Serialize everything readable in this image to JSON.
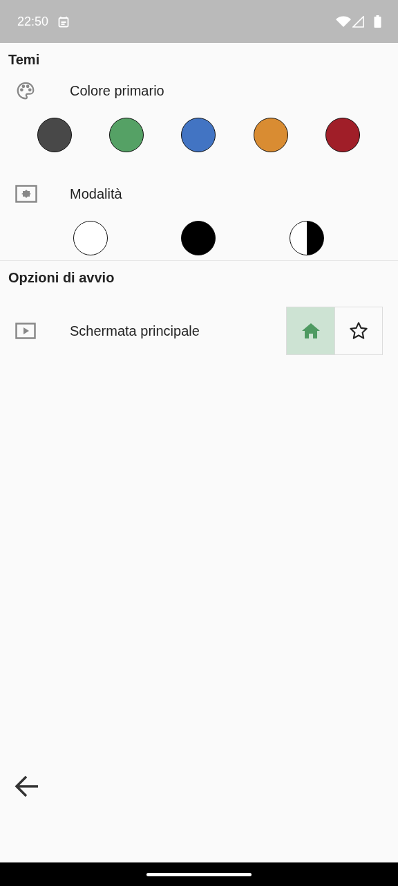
{
  "status_bar": {
    "time": "22:50"
  },
  "sections": [
    {
      "title": "Temi",
      "settings": [
        {
          "kind": "swatches",
          "label": "Colore primario",
          "options": [
            {
              "color": "#484848"
            },
            {
              "color": "#55a165"
            },
            {
              "color": "#4274c3"
            },
            {
              "color": "#d98c32"
            },
            {
              "color": "#a01e28"
            }
          ]
        },
        {
          "kind": "modes",
          "label": "Modalità",
          "options": [
            {
              "kind": "light"
            },
            {
              "kind": "dark"
            },
            {
              "kind": "auto"
            }
          ]
        }
      ]
    },
    {
      "title": "Opzioni di avvio",
      "settings": [
        {
          "kind": "toggle",
          "label": "Schermata principale",
          "options": [
            {
              "selected": true
            },
            {
              "selected": false
            }
          ]
        }
      ]
    }
  ]
}
